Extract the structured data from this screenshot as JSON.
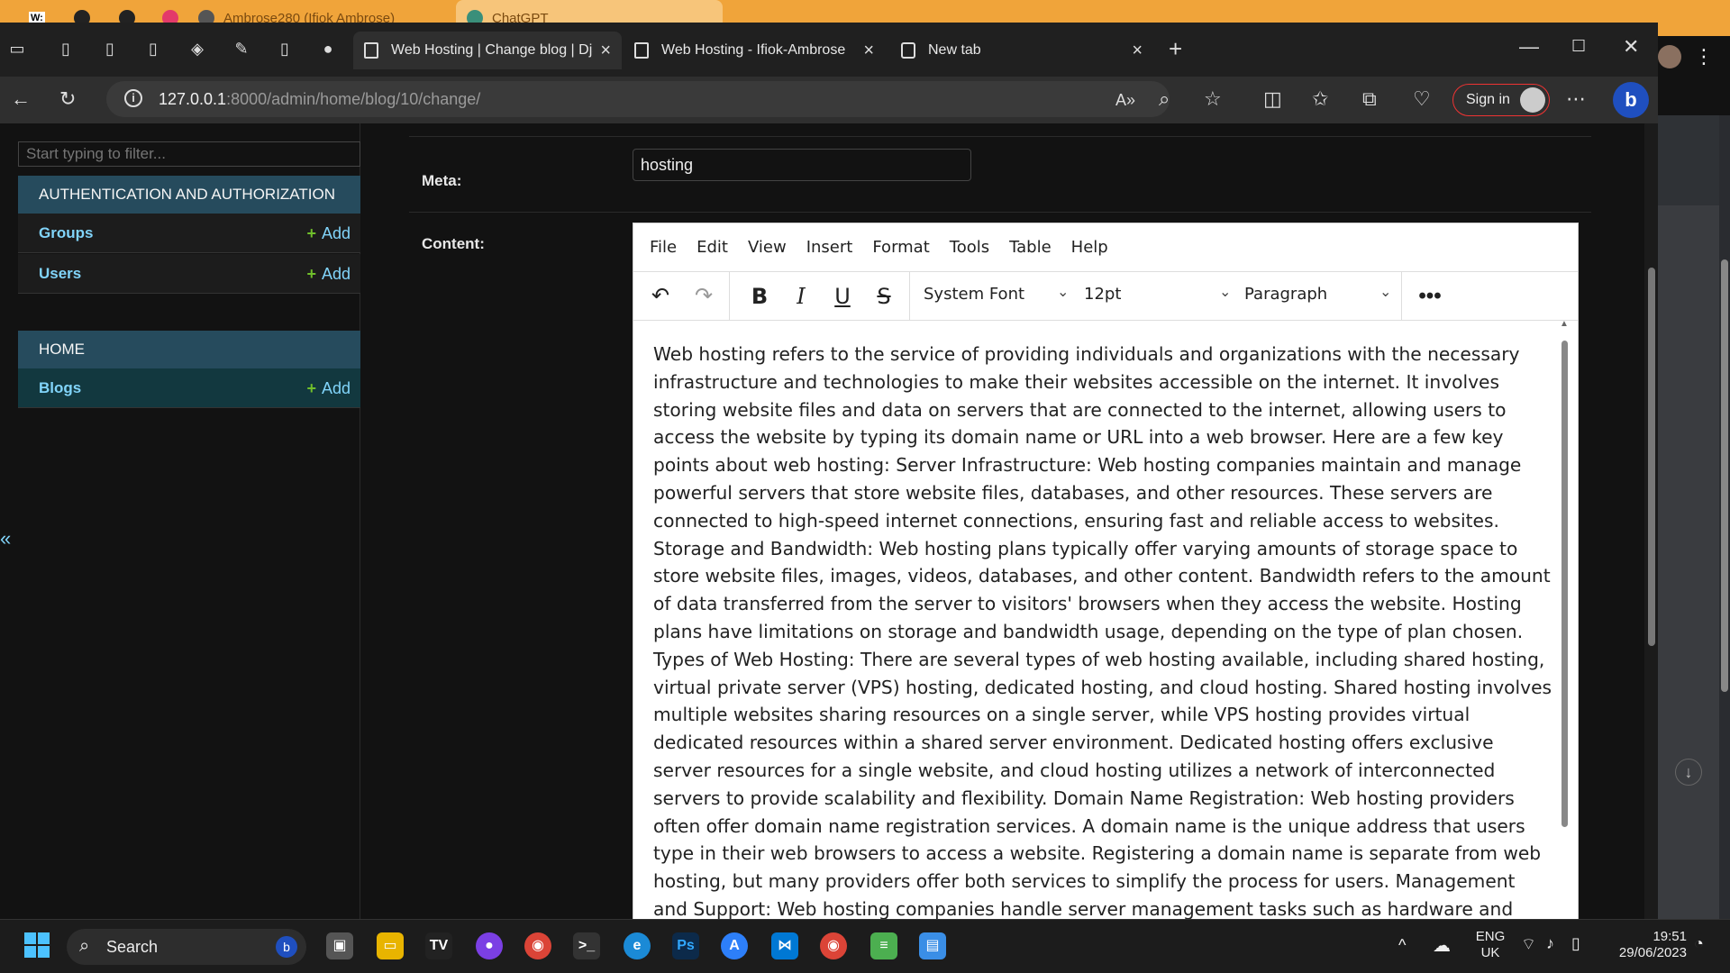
{
  "background_window": {
    "tabs": [
      "Ambrose280 (Ifiok Ambrose)",
      "ChatGPT"
    ]
  },
  "browser": {
    "tabs": [
      {
        "label": "Web Hosting | Change blog | Dja",
        "active": true
      },
      {
        "label": "Web Hosting - Ifiok-Ambrose",
        "active": false
      },
      {
        "label": "New tab",
        "active": false
      }
    ],
    "url_host": "127.0.0.1",
    "url_rest": ":8000/admin/home/blog/10/change/",
    "signin_label": "Sign in"
  },
  "sidebar": {
    "filter_placeholder": "Start typing to filter...",
    "sections": [
      {
        "title": "AUTHENTICATION AND AUTHORIZATION",
        "models": [
          {
            "name": "Groups",
            "add": "Add"
          },
          {
            "name": "Users",
            "add": "Add"
          }
        ]
      },
      {
        "title": "HOME",
        "models": [
          {
            "name": "Blogs",
            "add": "Add"
          }
        ]
      }
    ],
    "collapse_glyph": "«"
  },
  "form": {
    "meta_label": "Meta:",
    "meta_value": "hosting",
    "content_label": "Content:"
  },
  "editor": {
    "menu": [
      "File",
      "Edit",
      "View",
      "Insert",
      "Format",
      "Tools",
      "Table",
      "Help"
    ],
    "font_family": "System Font",
    "font_size": "12pt",
    "block_format": "Paragraph",
    "content": "Web hosting refers to the service of providing individuals and organizations with the necessary infrastructure and technologies to make their websites accessible on the internet. It involves storing website files and data on servers that are connected to the internet, allowing users to access the website by typing its domain name or URL into a web browser. Here are a few key points about web hosting: Server Infrastructure: Web hosting companies maintain and manage powerful servers that store website files, databases, and other resources. These servers are connected to high-speed internet connections, ensuring fast and reliable access to websites. Storage and Bandwidth: Web hosting plans typically offer varying amounts of storage space to store website files, images, videos, databases, and other content. Bandwidth refers to the amount of data transferred from the server to visitors' browsers when they access the website. Hosting plans have limitations on storage and bandwidth usage, depending on the type of plan chosen. Types of Web Hosting: There are several types of web hosting available, including shared hosting, virtual private server (VPS) hosting, dedicated hosting, and cloud hosting. Shared hosting involves multiple websites sharing resources on a single server, while VPS hosting provides virtual dedicated resources within a shared server environment. Dedicated hosting offers exclusive server resources for a single website, and cloud hosting utilizes a network of interconnected servers to provide scalability and flexibility. Domain Name Registration: Web hosting providers often offer domain name registration services. A domain name is the unique address that users type in their web browsers to access a website. Registering a domain name is separate from web hosting, but many providers offer both services to simplify the process for users. Management and Support: Web hosting companies handle server management tasks such as hardware and software maintenance, security updates, backups, and technical support. They ensure that the servers are running smoothly and address any issues or concerns that arise."
  },
  "taskbar": {
    "search_label": "Search",
    "language": "ENG",
    "region": "UK",
    "time": "19:51",
    "date": "29/06/2023"
  },
  "colors": {
    "admin_header": "#264b5d",
    "link": "#81d4fa",
    "add_plus": "#70bf2b",
    "page_bg": "#121212"
  }
}
